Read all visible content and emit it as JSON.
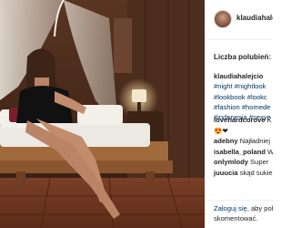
{
  "post": {
    "username": "klaudiahalejcio",
    "likes_label": "Liczba polubień: 3"
  },
  "caption": {
    "username": "klaudiahalejcio",
    "lines": [
      "#night #nightlook",
      "#lookbook #lookc",
      "#fashion #homede",
      "#indonesia #sexye"
    ]
  },
  "comments": [
    {
      "username": "lovehardcorove",
      "text": " K"
    },
    {
      "username": "",
      "text": "😍❤"
    },
    {
      "username": "adebny",
      "text": " Najładniej"
    },
    {
      "username": "isabella_poland",
      "text": " W"
    },
    {
      "username": "onlymlody",
      "text": " Super"
    },
    {
      "username": "juuucia",
      "text": " skąd sukie"
    }
  ],
  "footer": {
    "login_link": "Zaloguj się",
    "login_rest": ", aby polubić",
    "line2": "skomentować."
  }
}
